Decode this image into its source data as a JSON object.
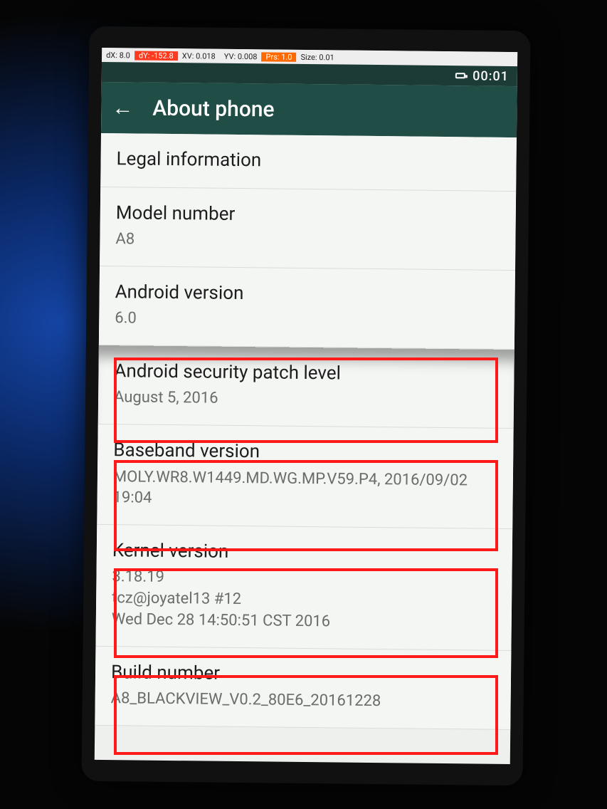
{
  "debug_bar": {
    "dx": "dX: 8.0",
    "dy": "dY: -152.8",
    "xv": "XV: 0.018",
    "yv": "YV: 0.008",
    "prs": "Prs: 1.0",
    "size": "Size: 0.01"
  },
  "status": {
    "time": "00:01"
  },
  "header": {
    "back_glyph": "←",
    "title": "About phone"
  },
  "items": {
    "legal": {
      "label": "Legal information",
      "value": ""
    },
    "model": {
      "label": "Model number",
      "value": "A8"
    },
    "android": {
      "label": "Android version",
      "value": "6.0"
    },
    "patch": {
      "label": "Android security patch level",
      "value": "August 5, 2016"
    },
    "baseband": {
      "label": "Baseband version",
      "value": "MOLY.WR8.W1449.MD.WG.MP.V59.P4, 2016/09/02 19:04"
    },
    "kernel": {
      "label": "Kernel version",
      "value": "3.18.19\ntcz@joyatel13 #12\nWed Dec 28 14:50:51 CST 2016"
    },
    "build": {
      "label": "Build number",
      "value": "A8_BLACKVIEW_V0.2_80E6_20161228"
    }
  }
}
